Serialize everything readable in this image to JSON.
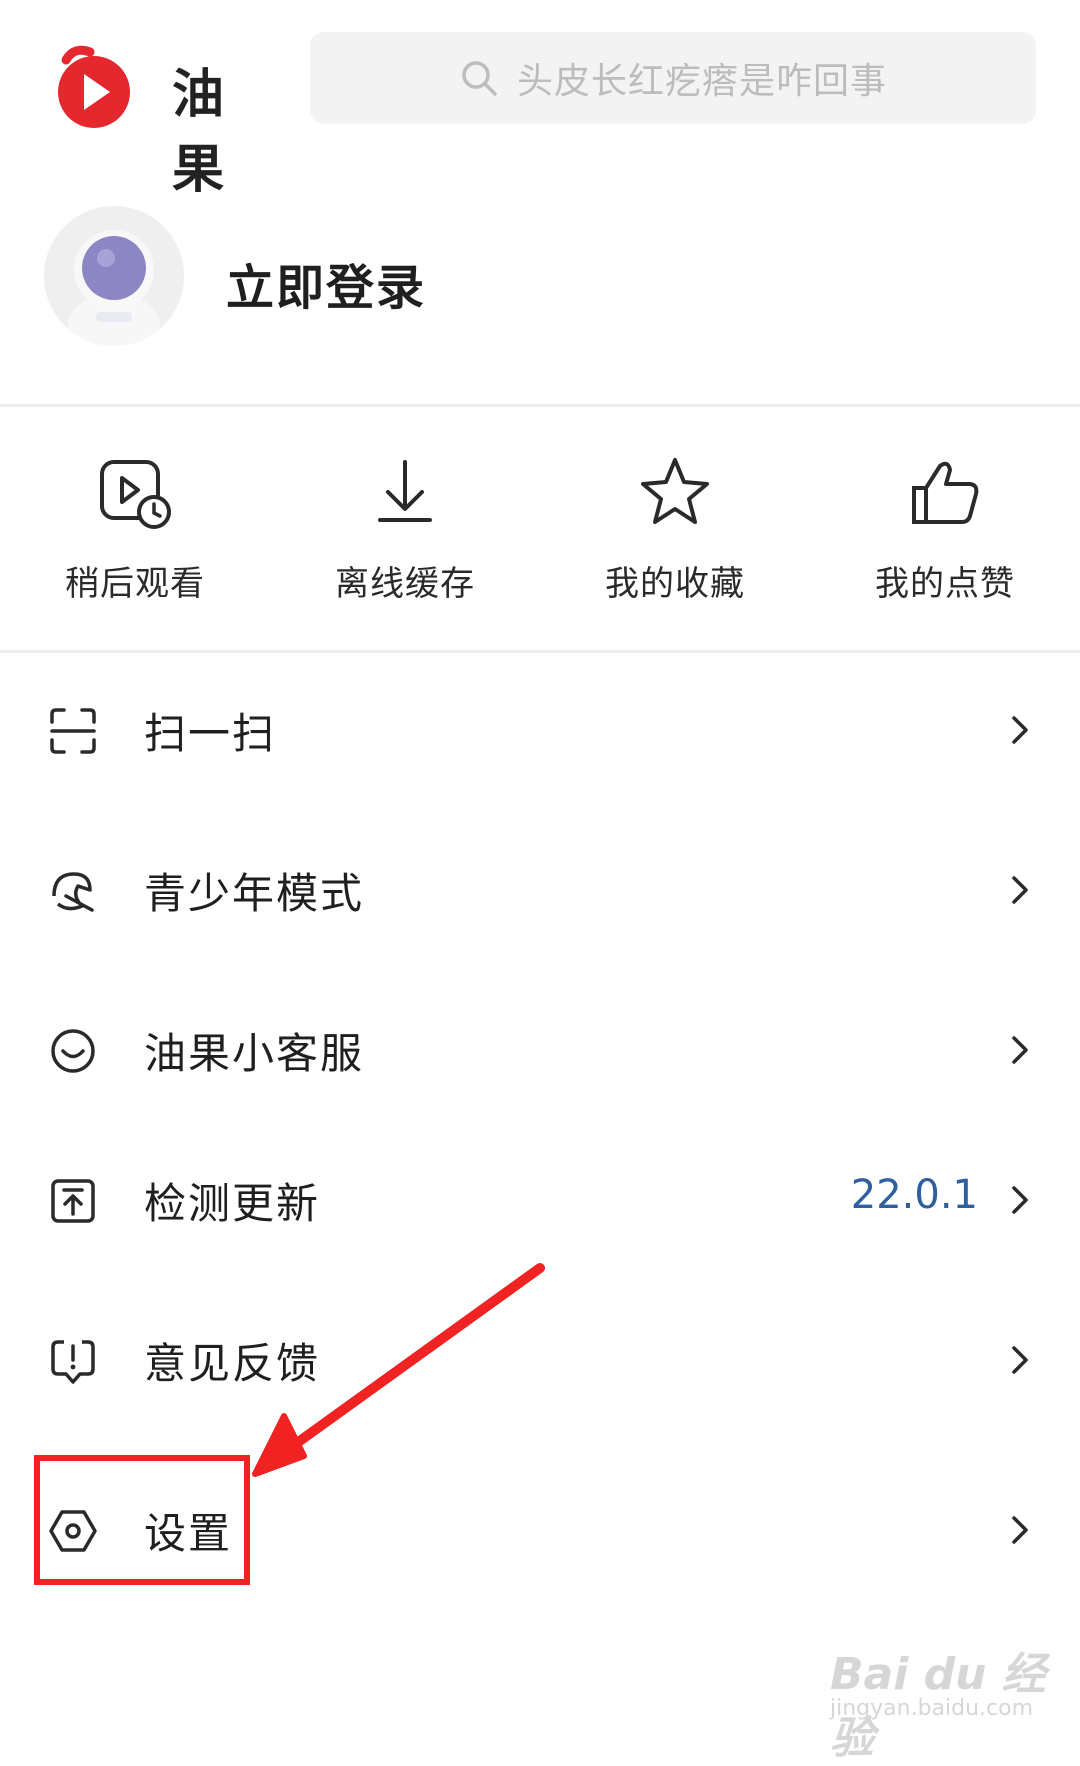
{
  "app": {
    "name": "油果",
    "brand_color": "#e5272e"
  },
  "search": {
    "placeholder": "头皮长红疙瘩是咋回事",
    "icon": "search-icon"
  },
  "profile": {
    "login_text": "立即登录",
    "avatar_icon": "astronaut-avatar"
  },
  "shortcuts": [
    {
      "label": "稍后观看",
      "icon": "watch-later-icon"
    },
    {
      "label": "离线缓存",
      "icon": "download-icon"
    },
    {
      "label": "我的收藏",
      "icon": "star-icon"
    },
    {
      "label": "我的点赞",
      "icon": "thumbs-up-icon"
    }
  ],
  "menu": [
    {
      "label": "扫一扫",
      "icon": "scan-icon",
      "value": ""
    },
    {
      "label": "青少年模式",
      "icon": "youth-mode-icon",
      "value": ""
    },
    {
      "label": "油果小客服",
      "icon": "customer-service-icon",
      "value": ""
    },
    {
      "label": "检测更新",
      "icon": "update-icon",
      "value": "22.0.1"
    },
    {
      "label": "意见反馈",
      "icon": "feedback-icon",
      "value": ""
    },
    {
      "label": "设置",
      "icon": "settings-icon",
      "value": ""
    }
  ],
  "annotation": {
    "color": "#f02222"
  },
  "watermark": {
    "main": "Bai du 经验",
    "sub": "jingyan.baidu.com"
  }
}
